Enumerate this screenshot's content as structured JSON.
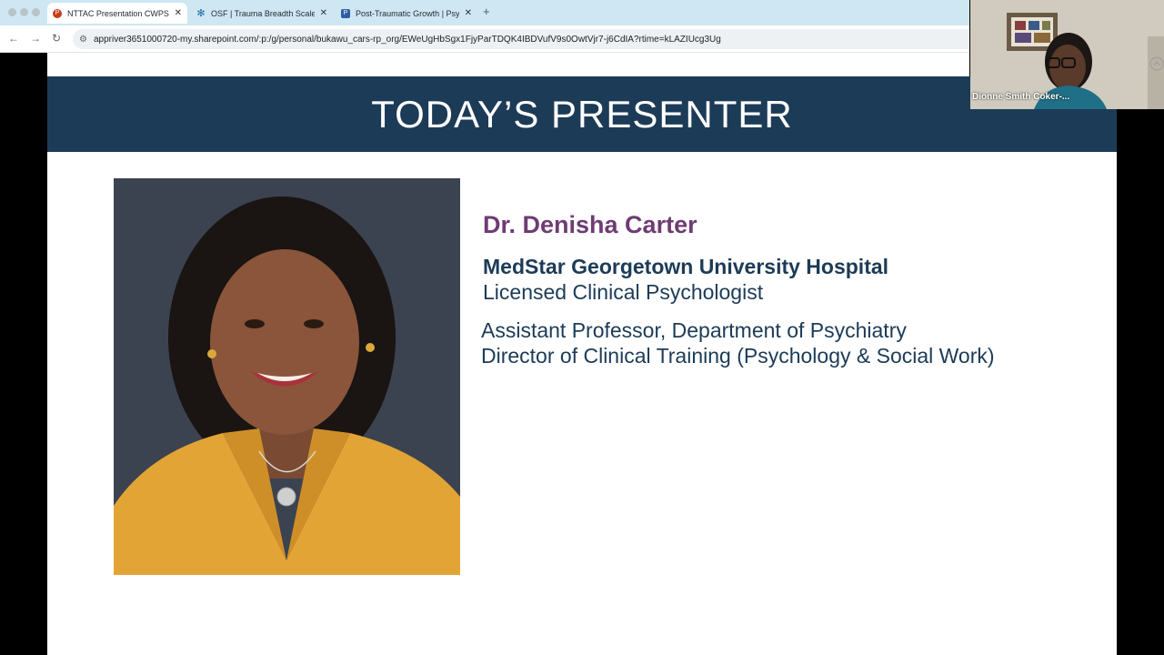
{
  "browser": {
    "tabs": [
      {
        "title": "NTTAC Presentation CWPS T",
        "icon": "powerpoint-icon",
        "color": "#c43e1c"
      },
      {
        "title": "OSF | Trauma Breadth Scale",
        "icon": "osf-icon",
        "color": "#1b6aa5"
      },
      {
        "title": "Post-Traumatic Growth | Psyc",
        "icon": "apa-icon",
        "color": "#2d5fa0"
      }
    ],
    "url": "appriver3651000720-my.sharepoint.com/:p:/g/personal/bukawu_cars-rp_org/EWeUgHbSgx1FjyParTDQK4IBDVufV9s0OwtVjr7-j6CdIA?rtime=kLAZIUcg3Ug"
  },
  "slide": {
    "title": "TODAY’S PRESENTER",
    "name": "Dr. Denisha Carter",
    "hospital": "MedStar Georgetown University Hospital",
    "role": "Licensed Clinical Psychologist",
    "position1": "Assistant Professor, Department of Psychiatry",
    "position2": "Director of Clinical Training (Psychology & Social Work)",
    "colors": {
      "banner": "#1c3b57",
      "name": "#6e3c73",
      "text": "#1c3b57"
    }
  },
  "video": {
    "participant_name": "Dionne Smith Coker-..."
  }
}
